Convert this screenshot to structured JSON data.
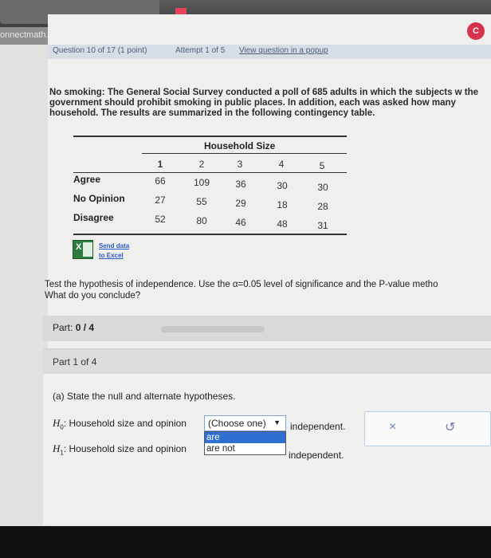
{
  "browser": {
    "url_fragment": "onnectmath.com",
    "tab_button": "C"
  },
  "question_bar": {
    "segments": [
      "Question 10 of 17 (1 point)",
      "Attempt 1 of 5",
      "View question in a popup"
    ]
  },
  "problem": {
    "label": "No smoking:",
    "text": " The General Social Survey conducted a poll of 685 adults in which the subjects w the government should prohibit smoking in public places. In addition, each was asked how many household. The results are summarized in the following contingency table."
  },
  "table": {
    "header": "Household Size",
    "columns": [
      "1",
      "2",
      "3",
      "4",
      "5"
    ],
    "rows": [
      {
        "label": "Agree",
        "values": [
          "66",
          "109",
          "36",
          "30",
          "30"
        ]
      },
      {
        "label": "No Opinion",
        "values": [
          "27",
          "55",
          "29",
          "18",
          "28"
        ]
      },
      {
        "label": "Disagree",
        "values": [
          "52",
          "80",
          "46",
          "48",
          "31"
        ]
      }
    ]
  },
  "send_data": {
    "line1": "Send data",
    "line2": "to Excel"
  },
  "test": {
    "line1": "Test the hypothesis of independence. Use the α=0.05 level of significance and the P-value metho",
    "line2": "What do you conclude?"
  },
  "part": {
    "label": "Part:",
    "value": "0 / 4",
    "progress_fraction": 0,
    "header": "Part 1 of 4"
  },
  "question_a": "(a) State the null and alternate hypotheses.",
  "h0": {
    "symbol": "H",
    "sub": "0",
    "prefix": ": Household size and opinion",
    "suffix": "independent."
  },
  "h1": {
    "symbol": "H",
    "sub": "1",
    "prefix": ": Household size and opinion",
    "suffix": "independent."
  },
  "dropdown": {
    "value": "(Choose one)",
    "options": [
      "are",
      "are not"
    ],
    "highlighted": "are"
  },
  "actions": {
    "clear": "×",
    "undo": "↺"
  },
  "colors": {
    "accent": "#2e6fd1",
    "link": "#2b58c9",
    "excel": "#2f7a3d"
  }
}
